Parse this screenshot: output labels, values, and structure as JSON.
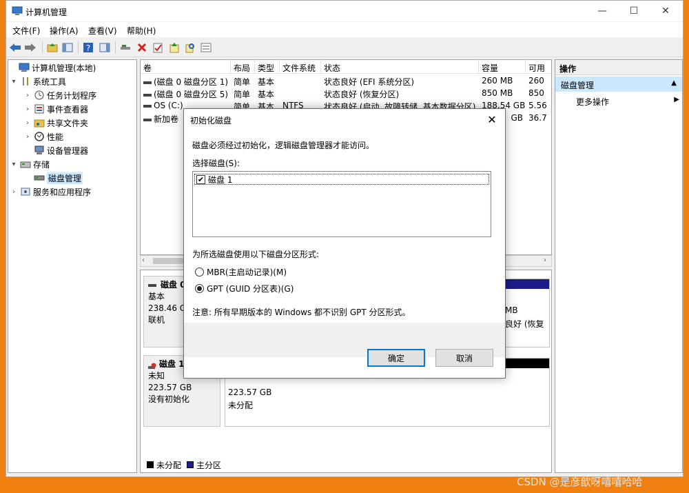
{
  "window": {
    "title": "计算机管理",
    "minimize": "—",
    "maximize": "☐",
    "close": "✕"
  },
  "menu": [
    "文件(F)",
    "操作(A)",
    "查看(V)",
    "帮助(H)"
  ],
  "tree": {
    "root": "计算机管理(本地)",
    "system_tools": "系统工具",
    "task_scheduler": "任务计划程序",
    "event_viewer": "事件查看器",
    "shared_folders": "共享文件夹",
    "performance": "性能",
    "device_manager": "设备管理器",
    "storage": "存储",
    "disk_management": "磁盘管理",
    "services": "服务和应用程序"
  },
  "volume_table": {
    "headers": [
      "卷",
      "布局",
      "类型",
      "文件系统",
      "状态",
      "容量",
      "可用"
    ],
    "rows": [
      [
        "(磁盘 0 磁盘分区 1)",
        "简单",
        "基本",
        "",
        "状态良好 (EFI 系统分区)",
        "260 MB",
        "260"
      ],
      [
        "(磁盘 0 磁盘分区 5)",
        "简单",
        "基本",
        "",
        "状态良好 (恢复分区)",
        "850 MB",
        "850"
      ],
      [
        "OS (C:)",
        "简单",
        "基本",
        "NTFS",
        "状态良好 (启动, 故障转储, 基本数据分区)",
        "188.54 GB",
        "5.56"
      ],
      [
        "新加卷",
        "",
        "",
        "",
        "",
        "GB",
        "36.7"
      ]
    ]
  },
  "disk0": {
    "name": "磁盘 0",
    "type": "基本",
    "size": "238.46 GB",
    "state": "联机",
    "part_fragment1": "MB",
    "part_fragment2": "良好 (恢复"
  },
  "disk1": {
    "name": "磁盘 1",
    "type": "未知",
    "size": "223.57 GB",
    "state": "没有初始化",
    "unalloc_size": "223.57 GB",
    "unalloc_label": "未分配"
  },
  "legend": {
    "unallocated": "未分配",
    "primary": "主分区"
  },
  "actions": {
    "header": "操作",
    "selected": "磁盘管理",
    "more": "更多操作"
  },
  "dialog": {
    "title": "初始化磁盘",
    "message": "磁盘必须经过初始化，逻辑磁盘管理器才能访问。",
    "select_label": "选择磁盘(S):",
    "disk_item": "磁盘 1",
    "style_label": "为所选磁盘使用以下磁盘分区形式:",
    "mbr": "MBR(主启动记录)(M)",
    "gpt": "GPT (GUID 分区表)(G)",
    "note": "注意: 所有早期版本的 Windows 都不识别 GPT 分区形式。",
    "ok": "确定",
    "cancel": "取消",
    "close": "✕"
  },
  "watermark": "CSDN @是彦歆呀嘻嘻哈哈",
  "colors": {
    "desktop": "#f0800f",
    "selection": "#cce8ff",
    "primary_partition": "#1c1c8c",
    "unallocated": "#000000",
    "accent": "#0078d7"
  }
}
